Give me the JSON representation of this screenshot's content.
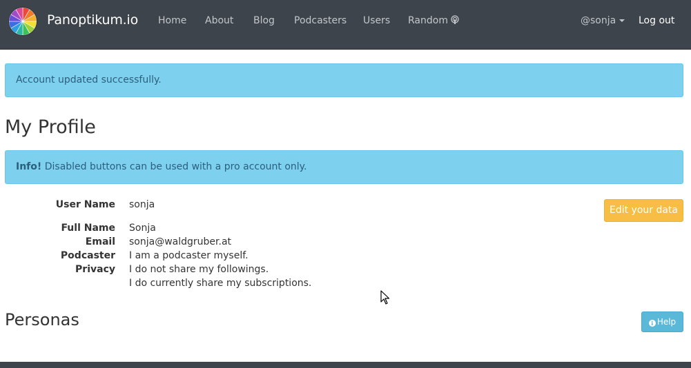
{
  "brand": "Panoptikum.io",
  "nav": [
    "Home",
    "About",
    "Blog",
    "Podcasters",
    "Users",
    "Random"
  ],
  "user_menu": "@sonja",
  "logout": "Log out",
  "alert_success": "Account updated successfully.",
  "page_title": "My Profile",
  "info": {
    "strong": "Info!",
    "text": " Disabled buttons can be used with a pro account only."
  },
  "profile": {
    "user_name_label": "User Name",
    "user_name": "sonja",
    "full_name_label": "Full Name",
    "full_name": "Sonja",
    "email_label": "Email",
    "email": "sonja@waldgruber.at",
    "podcaster_label": "Podcaster",
    "podcaster": "I am a podcaster myself.",
    "privacy_label": "Privacy",
    "privacy_1": "I do not share my followings.",
    "privacy_2": "I do currently share my subscriptions."
  },
  "edit_button": "Edit your data",
  "personas_title": "Personas",
  "help_button": "Help",
  "icons": {
    "logo": "color-wheel-logo",
    "random": "podcast-icon",
    "help": "info-circle-icon"
  },
  "colors": {
    "navbar": "#3e444c",
    "alert": "#7dd0ee",
    "warning": "#f7bd44",
    "info_btn": "#5ab9d8"
  }
}
